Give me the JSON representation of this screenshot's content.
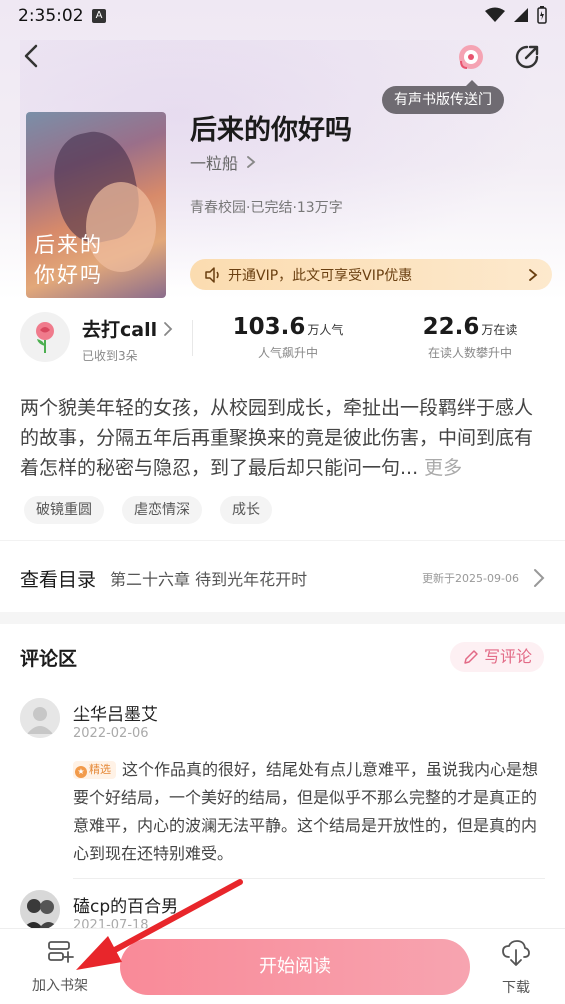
{
  "status_bar": {
    "time": "2:35:02",
    "indicator": "A"
  },
  "top_bar": {
    "audio_tooltip": "有声书版传送门"
  },
  "cover": {
    "line1": "后来的",
    "line2": "你好吗"
  },
  "book": {
    "title": "后来的你好吗",
    "author": "一粒船",
    "meta": "青春校园·已完结·13万字",
    "vip_banner": "开通VIP，此文可享受VIP优惠"
  },
  "stats": {
    "call_title": "去打call",
    "call_sub": "已收到3朵",
    "popularity_value": "103.6",
    "popularity_unit": "万人气",
    "popularity_label": "人气飙升中",
    "reading_value": "22.6",
    "reading_unit": "万在读",
    "reading_label": "在读人数攀升中"
  },
  "description": {
    "text": "两个貌美年轻的女孩，从校园到成长，牵扯出一段羁绊于感人的故事，分隔五年后再重聚换来的竟是彼此伤害，中间到底有着怎样的秘密与隐忍，到了最后却只能问一句...",
    "more": "更多"
  },
  "tags": [
    "破镜重圆",
    "虐恋情深",
    "成长"
  ],
  "catalog": {
    "label": "查看目录",
    "chapter": "第二十六章 待到光年花开时",
    "updated": "更新于2025-09-06"
  },
  "comments": {
    "title": "评论区",
    "write_label": "写评论",
    "items": [
      {
        "user": "尘华吕墨艾",
        "date": "2022-02-06",
        "badge": "精选",
        "text": "这个作品真的很好，结尾处有点儿意难平，虽说我内心是想要个好结局，一个美好的结局，但是似乎不那么完整的才是真正的意难平，内心的波澜无法平静。这个结局是开放性的，但是真的内心到现在还特别难受。"
      },
      {
        "user": "磕cp的百合男",
        "date": "2021-07-18"
      }
    ]
  },
  "bottom_bar": {
    "shelf_label": "加入书架",
    "read_label": "开始阅读",
    "download_label": "下载"
  },
  "colors": {
    "accent_pink": "#f98a98",
    "vip_gold": "#fbdcb0",
    "annotation_red": "#e8262b"
  },
  "icons": [
    "back-arrow-icon",
    "audio-book-icon",
    "share-icon",
    "speaker-icon",
    "chevron-right-icon",
    "rose-icon",
    "pencil-icon",
    "user-avatar-icon",
    "shelf-add-icon",
    "cloud-download-icon"
  ]
}
